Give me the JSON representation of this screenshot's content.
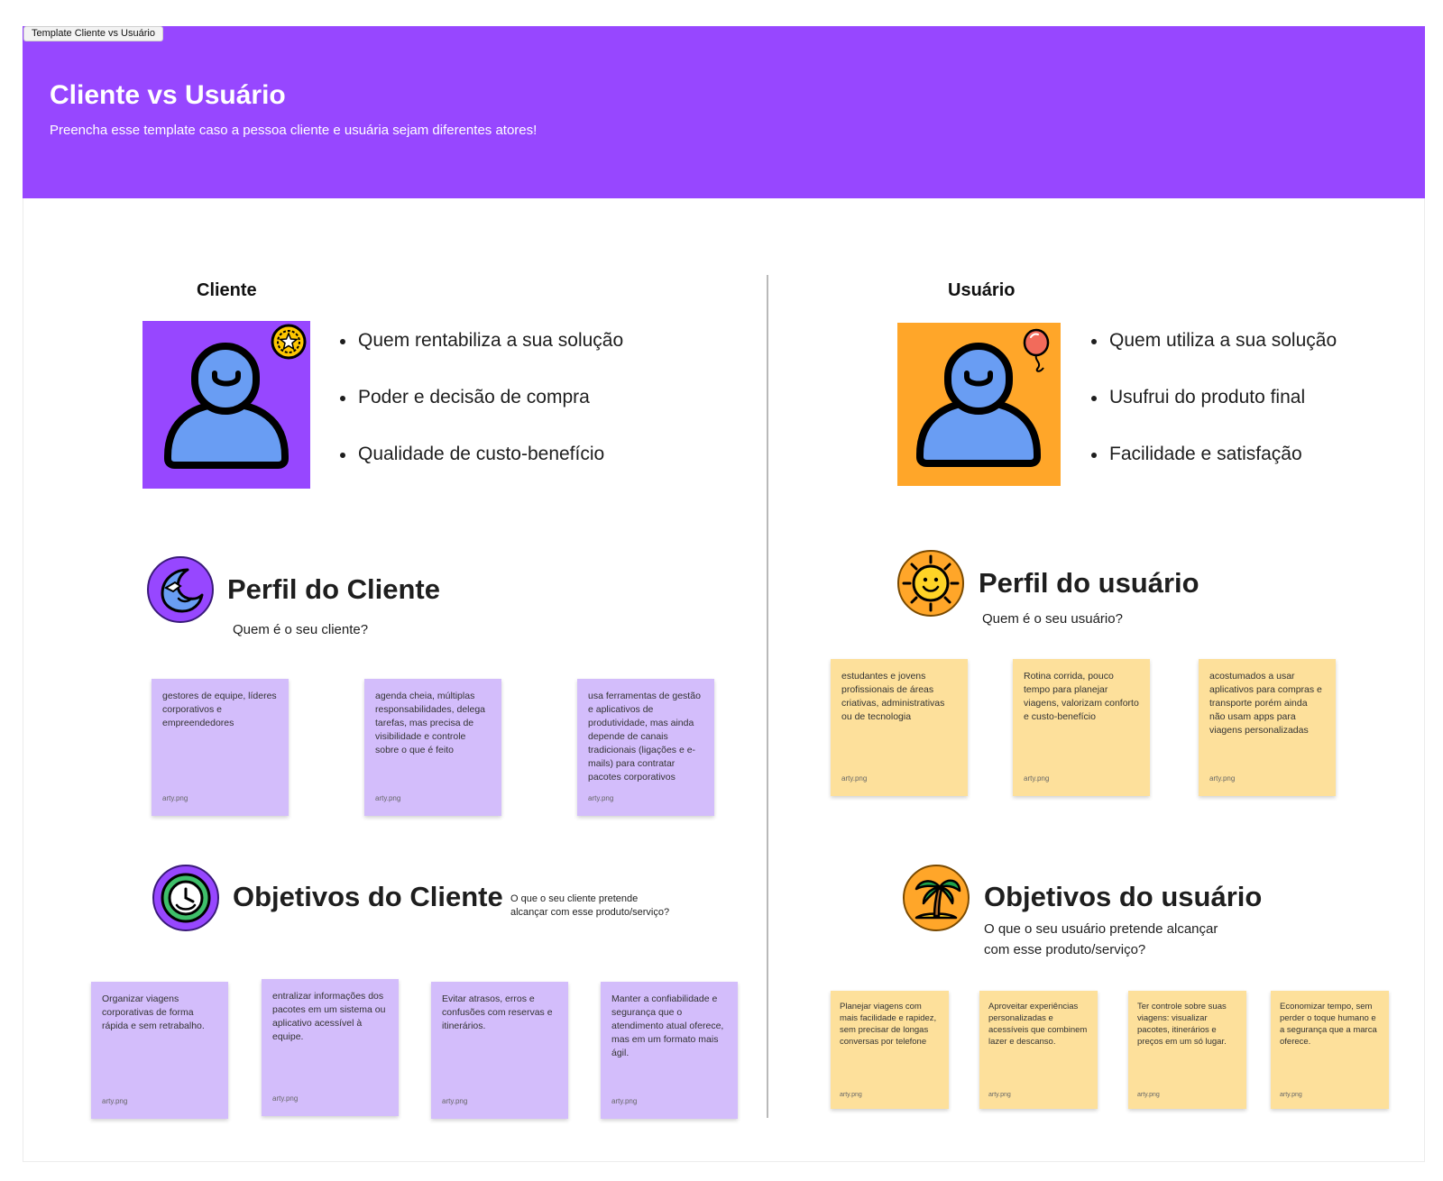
{
  "frame": {
    "tag": "Template Cliente vs Usuário"
  },
  "header": {
    "title": "Cliente vs Usuário",
    "subtitle": "Preencha esse template caso a pessoa cliente e usuária sejam diferentes atores!"
  },
  "colors": {
    "purple": "#9747ff",
    "orange": "#ffa629",
    "sticky_purple": "#d3bdfb",
    "sticky_yellow": "#fde09b"
  },
  "cliente": {
    "label": "Cliente",
    "avatar_icons": [
      "person-icon",
      "star-coin-icon"
    ],
    "bullets": [
      "Quem rentabiliza a sua solução",
      "Poder e decisão de compra",
      "Qualidade de custo-benefício"
    ],
    "perfil": {
      "icon": "moon-icon",
      "title": "Perfil do Cliente",
      "question": "Quem é o seu cliente?",
      "notes": [
        {
          "text": "gestores de equipe, líderes corporativos e empreendedores",
          "author": "arty.png"
        },
        {
          "text": "agenda cheia, múltiplas responsabilidades, delega tarefas, mas precisa de visibilidade e controle sobre o que é feito",
          "author": "arty.png"
        },
        {
          "text": "usa ferramentas de gestão e aplicativos de produtividade, mas ainda depende de canais tradicionais (ligações e e-mails) para contratar pacotes corporativos",
          "author": "arty.png"
        }
      ]
    },
    "objetivos": {
      "icon": "clock-icon",
      "title": "Objetivos do Cliente",
      "question_line1": "O que o seu cliente pretende",
      "question_line2": "alcançar com esse produto/serviço?",
      "notes": [
        {
          "text": "Organizar viagens corporativas de forma rápida e sem retrabalho.",
          "author": "arty.png"
        },
        {
          "text": "entralizar informações dos pacotes em um sistema ou aplicativo acessível à equipe.",
          "author": "arty.png"
        },
        {
          "text": "Evitar atrasos, erros e confusões com reservas e itinerários.",
          "author": "arty.png"
        },
        {
          "text": "Manter a confiabilidade e segurança que o atendimento atual oferece, mas em um formato mais ágil.",
          "author": "arty.png"
        }
      ]
    }
  },
  "usuario": {
    "label": "Usuário",
    "avatar_icons": [
      "person-icon",
      "balloon-icon"
    ],
    "bullets": [
      "Quem utiliza a sua solução",
      "Usufrui do produto final",
      "Facilidade e satisfação"
    ],
    "perfil": {
      "icon": "sun-icon",
      "title": "Perfil do usuário",
      "question": "Quem é o seu usuário?",
      "notes": [
        {
          "text": " estudantes e jovens profissionais de áreas criativas, administrativas ou de tecnologia",
          "author": "arty.png"
        },
        {
          "text": "Rotina corrida, pouco tempo para planejar viagens, valorizam conforto e custo-benefício",
          "author": "arty.png"
        },
        {
          "text": "acostumados a usar aplicativos para compras e transporte porém ainda não usam apps para viagens personalizadas",
          "author": "arty.png"
        }
      ]
    },
    "objetivos": {
      "icon": "palm-tree-icon",
      "title": "Objetivos do usuário",
      "question_line1": "O que o seu usuário pretende alcançar",
      "question_line2": "com esse produto/serviço?",
      "notes": [
        {
          "text": "Planejar viagens com mais facilidade e rapidez, sem precisar de longas conversas por telefone",
          "author": "arty.png"
        },
        {
          "text": "Aproveitar experiências personalizadas e acessíveis que combinem lazer e descanso.",
          "author": "arty.png"
        },
        {
          "text": "Ter controle sobre suas viagens: visualizar pacotes, itinerários e preços em um só lugar.",
          "author": "arty.png"
        },
        {
          "text": "Economizar tempo, sem perder o toque humano e a segurança que a marca oferece.",
          "author": "arty.png"
        }
      ]
    }
  }
}
